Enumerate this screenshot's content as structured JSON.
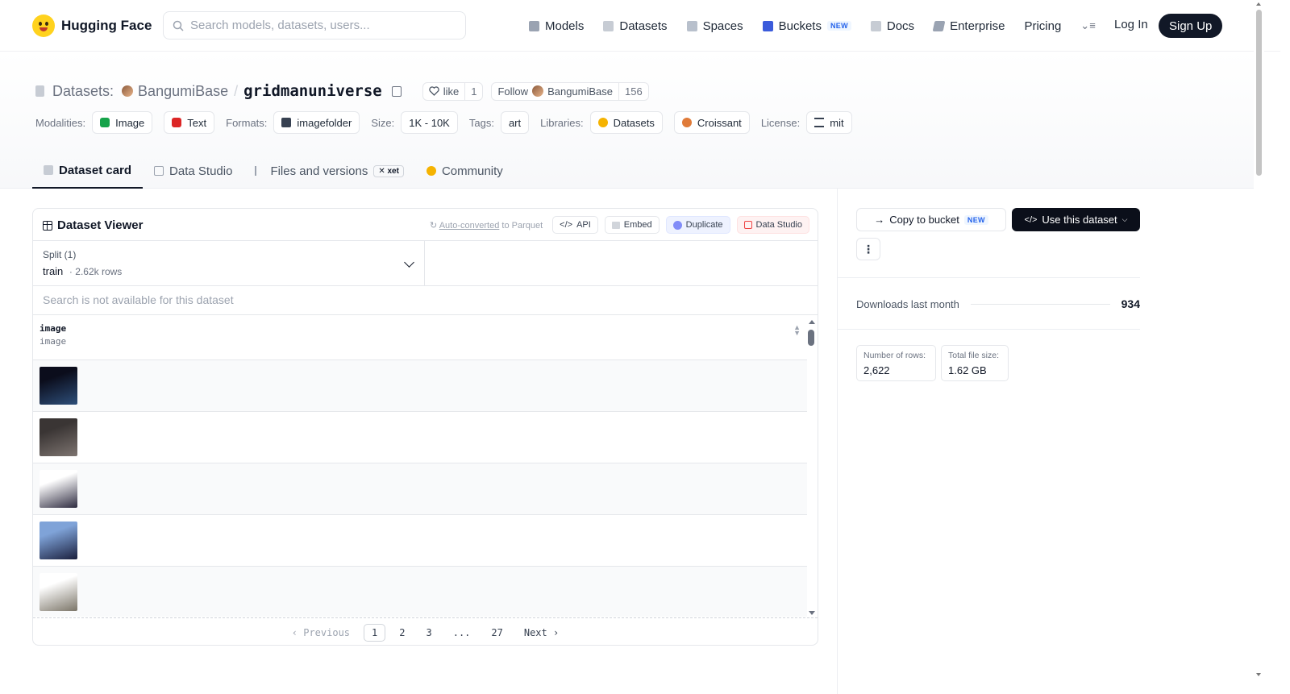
{
  "nav": {
    "brand": "Hugging Face",
    "search_placeholder": "Search models, datasets, users...",
    "links": [
      {
        "label": "Models",
        "icon": "cube-icon"
      },
      {
        "label": "Datasets",
        "icon": "database-icon"
      },
      {
        "label": "Spaces",
        "icon": "grid-icon"
      },
      {
        "label": "Buckets",
        "icon": "bucket-icon",
        "badge": "NEW"
      },
      {
        "label": "Docs",
        "icon": "book-icon"
      },
      {
        "label": "Enterprise",
        "icon": "enterprise-icon"
      },
      {
        "label": "Pricing"
      }
    ],
    "login": "Log In",
    "signup": "Sign Up"
  },
  "header": {
    "prefix": "Datasets:",
    "owner": "BangumiBase",
    "repo": "gridmanuniverse",
    "like_label": "like",
    "like_count": "1",
    "follow_label": "Follow",
    "follow_owner": "BangumiBase",
    "follow_count": "156",
    "tags": [
      {
        "label": "Modalities:",
        "items": [
          {
            "text": "Image",
            "color": "#16a34a"
          },
          {
            "text": "Text",
            "color": "#dc2626"
          }
        ]
      },
      {
        "label": "Formats:",
        "items": [
          {
            "text": "imagefolder",
            "color": "#374151"
          }
        ]
      },
      {
        "label": "Size:",
        "items": [
          {
            "text": "1K - 10K"
          }
        ]
      },
      {
        "label": "Tags:",
        "items": [
          {
            "text": "art"
          }
        ]
      },
      {
        "label": "Libraries:",
        "items": [
          {
            "text": "Datasets",
            "color": "#f5b301"
          },
          {
            "text": "Croissant",
            "color": "#e07b39"
          }
        ]
      },
      {
        "label": "License:",
        "items": [
          {
            "text": "mit",
            "color": "#374151"
          }
        ]
      }
    ],
    "tabs": [
      {
        "label": "Dataset card",
        "active": true
      },
      {
        "label": "Data Studio"
      },
      {
        "label": "Files and versions",
        "badge": "xet"
      },
      {
        "label": "Community"
      }
    ]
  },
  "viewer": {
    "title": "Dataset Viewer",
    "auto_converted": "Auto-converted",
    "auto_converted_suffix": "to Parquet",
    "actions": [
      "API",
      "Embed",
      "Duplicate",
      "Data Studio"
    ],
    "split_label": "Split (1)",
    "split_value": "train",
    "split_rows": "2.62k rows",
    "search_na": "Search is not available for this dataset",
    "column": {
      "name": "image",
      "type": "image"
    },
    "rows": [
      {
        "colors": [
          "#0b0d1c",
          "#2e4f7a"
        ]
      },
      {
        "colors": [
          "#3a3534",
          "#7d7470"
        ]
      },
      {
        "colors": [
          "#ffffff",
          "#2d2a3f"
        ]
      },
      {
        "colors": [
          "#7fa3d8",
          "#1a1f3d"
        ]
      },
      {
        "colors": [
          "#ffffff",
          "#7b7568"
        ]
      }
    ],
    "pager": {
      "previous": "Previous",
      "pages": [
        "1",
        "2",
        "3",
        "...",
        "27"
      ],
      "current": "1",
      "next": "Next"
    }
  },
  "sidebar": {
    "copy_bucket": "Copy to bucket",
    "copy_badge": "NEW",
    "use_dataset": "Use this dataset",
    "downloads_label": "Downloads last month",
    "downloads_value": "934",
    "stats": [
      {
        "label": "Number of rows:",
        "value": "2,622"
      },
      {
        "label": "Total file size:",
        "value": "1.62 GB"
      }
    ]
  }
}
